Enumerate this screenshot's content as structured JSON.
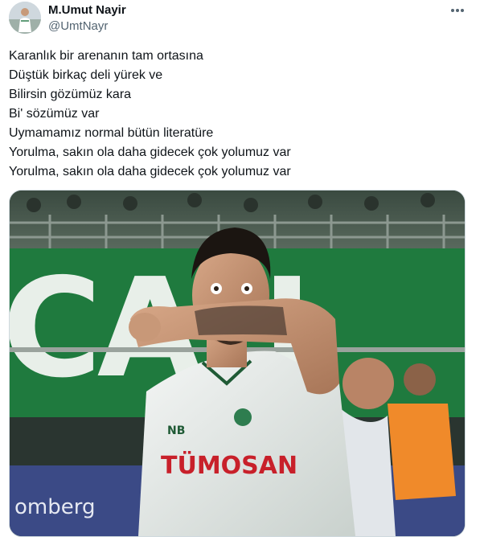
{
  "author": {
    "display_name": "M.Umut Nayir",
    "handle": "@UmtNayr",
    "avatar_icon": "user-avatar"
  },
  "menu": {
    "icon": "more-horizontal-icon"
  },
  "tweet": {
    "lines": [
      "Karanlık bir arenanın tam ortasına",
      "Düştük birkaç deli yürek ve",
      "Bilirsin gözümüz kara",
      "Bi' sözümüz var",
      "Uymamamız normal bütün literatüre",
      "Yorulma, sakın ola daha gidecek çok yolumuz var",
      "Yorulma, sakın ola daha gidecek çok yolumuz var"
    ]
  },
  "photo": {
    "banner_text": "CAH",
    "sponsor_text": "TÜMOSAN",
    "kit_brand": "NB",
    "board_text": "omberg",
    "colors": {
      "banner_green": "#1f7a3e",
      "vest_orange": "#f08a2a",
      "sponsor_red": "#c8202a"
    }
  }
}
